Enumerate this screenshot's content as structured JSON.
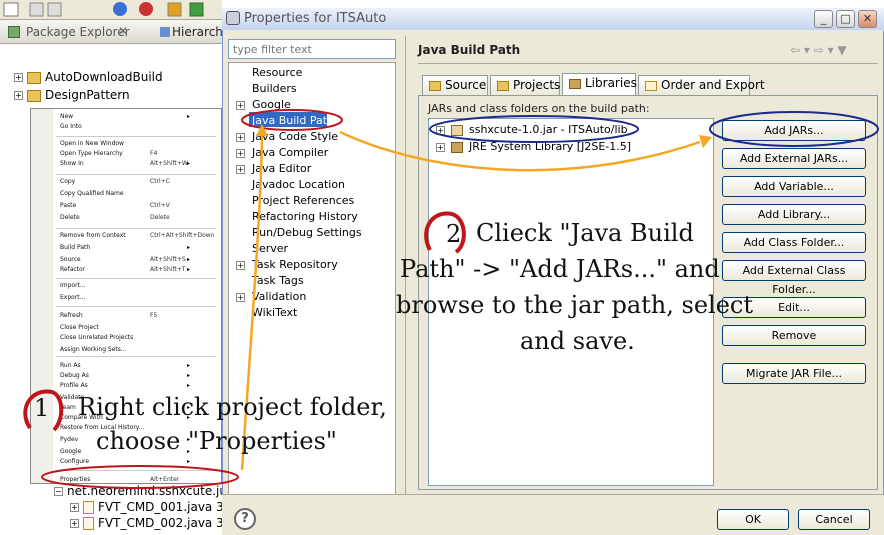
{
  "package_explorer": {
    "tab_title": "Package Explorer",
    "close_glyph": "✕",
    "hierarchy_tab": "Hierarchy",
    "tree": [
      {
        "label": "AutoDownloadBuild",
        "expander": "+"
      },
      {
        "label": "DesignPattern",
        "expander": "+"
      },
      {
        "label": "net.neoremind.sshxcute.ju",
        "expander": "−"
      },
      {
        "label": "FVT_CMD_001.java 3",
        "expander": "+"
      },
      {
        "label": "FVT_CMD_002.java 3",
        "expander": "+"
      }
    ]
  },
  "context_menu": {
    "items": [
      {
        "label": "New",
        "shortcut": "",
        "arrow": "▸"
      },
      {
        "label": "Go Into",
        "shortcut": "",
        "arrow": ""
      },
      {
        "label": "Open in New Window",
        "shortcut": "",
        "arrow": ""
      },
      {
        "label": "Open Type Hierarchy",
        "shortcut": "F4",
        "arrow": ""
      },
      {
        "label": "Show In",
        "shortcut": "Alt+Shift+W",
        "arrow": "▸"
      },
      {
        "label": "Copy",
        "shortcut": "Ctrl+C",
        "arrow": ""
      },
      {
        "label": "Copy Qualified Name",
        "shortcut": "",
        "arrow": ""
      },
      {
        "label": "Paste",
        "shortcut": "Ctrl+V",
        "arrow": ""
      },
      {
        "label": "Delete",
        "shortcut": "Delete",
        "arrow": ""
      },
      {
        "label": "Remove from Context",
        "shortcut": "Ctrl+Alt+Shift+Down",
        "arrow": ""
      },
      {
        "label": "Build Path",
        "shortcut": "",
        "arrow": "▸"
      },
      {
        "label": "Source",
        "shortcut": "Alt+Shift+S",
        "arrow": "▸"
      },
      {
        "label": "Refactor",
        "shortcut": "Alt+Shift+T",
        "arrow": "▸"
      },
      {
        "label": "Import...",
        "shortcut": "",
        "arrow": ""
      },
      {
        "label": "Export...",
        "shortcut": "",
        "arrow": ""
      },
      {
        "label": "Refresh",
        "shortcut": "F5",
        "arrow": ""
      },
      {
        "label": "Close Project",
        "shortcut": "",
        "arrow": ""
      },
      {
        "label": "Close Unrelated Projects",
        "shortcut": "",
        "arrow": ""
      },
      {
        "label": "Assign Working Sets...",
        "shortcut": "",
        "arrow": ""
      },
      {
        "label": "Run As",
        "shortcut": "",
        "arrow": "▸"
      },
      {
        "label": "Debug As",
        "shortcut": "",
        "arrow": "▸"
      },
      {
        "label": "Profile As",
        "shortcut": "",
        "arrow": "▸"
      },
      {
        "label": "Validate",
        "shortcut": "",
        "arrow": ""
      },
      {
        "label": "Team",
        "shortcut": "",
        "arrow": "▸"
      },
      {
        "label": "Compare With",
        "shortcut": "",
        "arrow": "▸"
      },
      {
        "label": "Restore from Local History...",
        "shortcut": "",
        "arrow": ""
      },
      {
        "label": "Pydev",
        "shortcut": "",
        "arrow": "▸"
      },
      {
        "label": "Google",
        "shortcut": "",
        "arrow": "▸"
      },
      {
        "label": "Configure",
        "shortcut": "",
        "arrow": "▸"
      },
      {
        "label": "Properties",
        "shortcut": "Alt+Enter",
        "arrow": ""
      }
    ]
  },
  "dialog": {
    "title": "Properties for ITSAuto",
    "window_buttons": {
      "minimize": "_",
      "maximize": "□",
      "close": "✕"
    },
    "filter_placeholder": "type filter text",
    "categories": [
      {
        "label": "Resource",
        "expander": ""
      },
      {
        "label": "Builders",
        "expander": ""
      },
      {
        "label": "Google",
        "expander": "+"
      },
      {
        "label": "Java Build Path",
        "expander": ""
      },
      {
        "label": "Java Code Style",
        "expander": "+"
      },
      {
        "label": "Java Compiler",
        "expander": "+"
      },
      {
        "label": "Java Editor",
        "expander": "+"
      },
      {
        "label": "Javadoc Location",
        "expander": ""
      },
      {
        "label": "Project References",
        "expander": ""
      },
      {
        "label": "Refactoring History",
        "expander": ""
      },
      {
        "label": "Run/Debug Settings",
        "expander": ""
      },
      {
        "label": "Server",
        "expander": ""
      },
      {
        "label": "Task Repository",
        "expander": "+"
      },
      {
        "label": "Task Tags",
        "expander": ""
      },
      {
        "label": "Validation",
        "expander": "+"
      },
      {
        "label": "WikiText",
        "expander": ""
      }
    ],
    "page_title": "Java Build Path",
    "nav_glyphs": "⇦ ▾ ⇨ ▾   ▼",
    "tabs": [
      "Source",
      "Projects",
      "Libraries",
      "Order and Export"
    ],
    "active_tab": "Libraries",
    "libs_label": "JARs and class folders on the build path:",
    "libraries": [
      {
        "label": "sshxcute-1.0.jar - ITSAuto/lib",
        "expander": "+"
      },
      {
        "label": "JRE System Library [J2SE-1.5]",
        "expander": "+"
      }
    ],
    "side_buttons": [
      "Add JARs...",
      "Add External JARs...",
      "Add Variable...",
      "Add Library...",
      "Add Class Folder...",
      "Add External Class Folder...",
      "Edit...",
      "Remove",
      "Migrate JAR File..."
    ],
    "help_glyph": "?",
    "ok_label": "OK",
    "cancel_label": "Cancel"
  },
  "annotations": {
    "step1_number": "1",
    "step1_line1": "Right  click project folder,",
    "step1_line2": "choose \"Properties\"",
    "step2_number": "2",
    "step2_line1": "Clieck \"Java Build",
    "step2_line2": "Path\" -> \"Add JARs...\" and",
    "step2_line3": "browse to the jar path, select",
    "step2_line4": "and save.",
    "highlight_color": "#c0151b",
    "ellipse_color": "#1c2a8c",
    "arrow_color": "#f5a623"
  }
}
